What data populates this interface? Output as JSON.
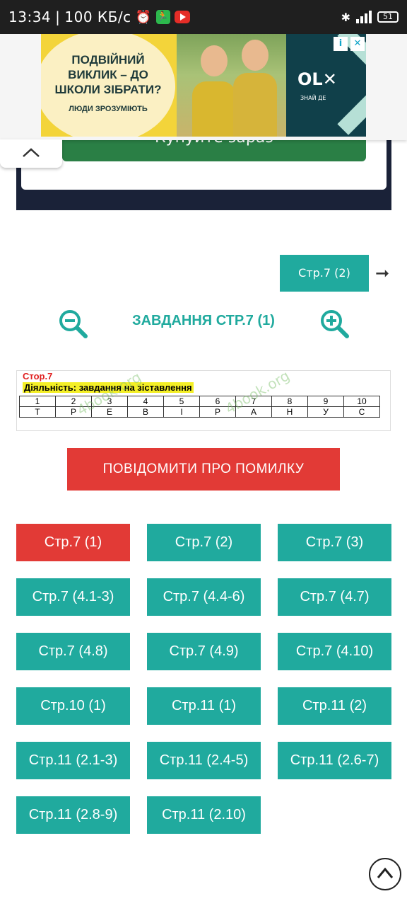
{
  "status_bar": {
    "time": "13:34",
    "speed": "100 КБ/с",
    "battery": "51"
  },
  "ad": {
    "headline": "ПОДВІЙНИЙ ВИКЛИК – ДО ШКОЛИ ЗІБРАТИ?",
    "subline": "ЛЮДИ ЗРОЗУМІЮТЬ",
    "brand": "OL✕",
    "brand_tagline": "ЗНАЙ ДЕ",
    "info_badge": "i",
    "close_badge": "✕",
    "cta_partial": "Купуйте зараз"
  },
  "nav": {
    "next_label": "Стр.7 (2)",
    "next_arrow": "➞",
    "title": "ЗАВДАННЯ СТР.7 (1)"
  },
  "task_image": {
    "page_label": "Стор.7",
    "subtitle": "Діяльність: завдання на зіставлення",
    "numbers": [
      "1",
      "2",
      "3",
      "4",
      "5",
      "6",
      "7",
      "8",
      "9",
      "10"
    ],
    "letters": [
      "Т",
      "Р",
      "Е",
      "В",
      "І",
      "Р",
      "А",
      "Н",
      "У",
      "С"
    ],
    "watermark": "4book.org"
  },
  "report_label": "ПОВІДОМИТИ ПРО ПОМИЛКУ",
  "pages": [
    {
      "label": "Стр.7 (1)",
      "active": true
    },
    {
      "label": "Стр.7 (2)"
    },
    {
      "label": "Стр.7 (3)"
    },
    {
      "label": "Стр.7 (4.1-3)"
    },
    {
      "label": "Стр.7 (4.4-6)"
    },
    {
      "label": "Стр.7 (4.7)"
    },
    {
      "label": "Стр.7 (4.8)"
    },
    {
      "label": "Стр.7 (4.9)"
    },
    {
      "label": "Стр.7 (4.10)"
    },
    {
      "label": "Стр.10 (1)"
    },
    {
      "label": "Стр.11 (1)"
    },
    {
      "label": "Стр.11 (2)"
    },
    {
      "label": "Стр.11 (2.1-3)"
    },
    {
      "label": "Стр.11 (2.4-5)"
    },
    {
      "label": "Стр.11 (2.6-7)"
    },
    {
      "label": "Стр.11 (2.8-9)"
    },
    {
      "label": "Стр.11 (2.10)"
    }
  ],
  "colors": {
    "teal": "#20aa9e",
    "red": "#e23a36",
    "dark_navy": "#1a2238"
  }
}
